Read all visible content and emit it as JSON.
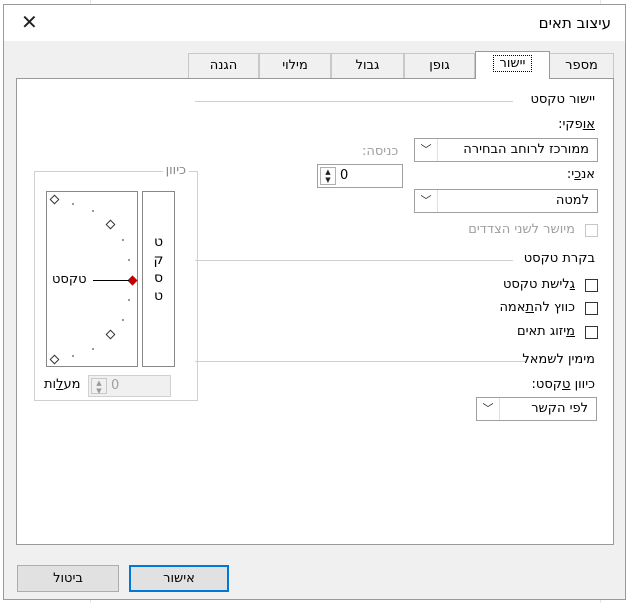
{
  "window": {
    "title": "עיצוב תאים"
  },
  "tabs": [
    {
      "label": "מספר"
    },
    {
      "label": "יישור",
      "active": true
    },
    {
      "label": "גופן"
    },
    {
      "label": "גבול"
    },
    {
      "label": "מילוי"
    },
    {
      "label": "הגנה"
    }
  ],
  "alignment": {
    "section_title": "יישור טקסט",
    "horizontal": {
      "label_u": "או",
      "label_rest": "פקי:",
      "value": "ממורכז לרוחב הבחירה"
    },
    "vertical": {
      "label_pre": "אנ",
      "label_u": "כ",
      "label_post": "י:",
      "value": "למטה"
    },
    "indent": {
      "label": "כניסה:",
      "value": "0"
    },
    "justify_distributed": {
      "label": "מיושר לשני הצדדים",
      "checked": false,
      "disabled": true
    }
  },
  "text_control": {
    "section_title": "בקרת טקסט",
    "wrap": {
      "label_u": "ג",
      "label_rest": "לישת טקסט",
      "checked": false
    },
    "shrink": {
      "label_pre": "כווץ לה",
      "label_u": "ת",
      "label_post": "אמה",
      "checked": false
    },
    "merge": {
      "label_u": "מ",
      "label_rest": "יזוג תאים",
      "checked": false
    }
  },
  "rtl": {
    "section_title": "מימין לשמאל",
    "direction": {
      "label_pre": "כיוון ",
      "label_u": "ט",
      "label_post": "קסט:",
      "value": "לפי הקשר"
    }
  },
  "orientation": {
    "label": "כיוון",
    "vertical_chars": [
      "ט",
      "ק",
      "ס",
      "ט"
    ],
    "dial_text": "טקסט",
    "degrees_label_pre": "מע",
    "degrees_label_u": "ל",
    "degrees_label_post": "ות",
    "degrees_value": "0"
  },
  "footer": {
    "ok": "אישור",
    "cancel": "ביטול"
  },
  "colors": {
    "accent": "#0078d7",
    "dial_marker": "#c00000"
  }
}
